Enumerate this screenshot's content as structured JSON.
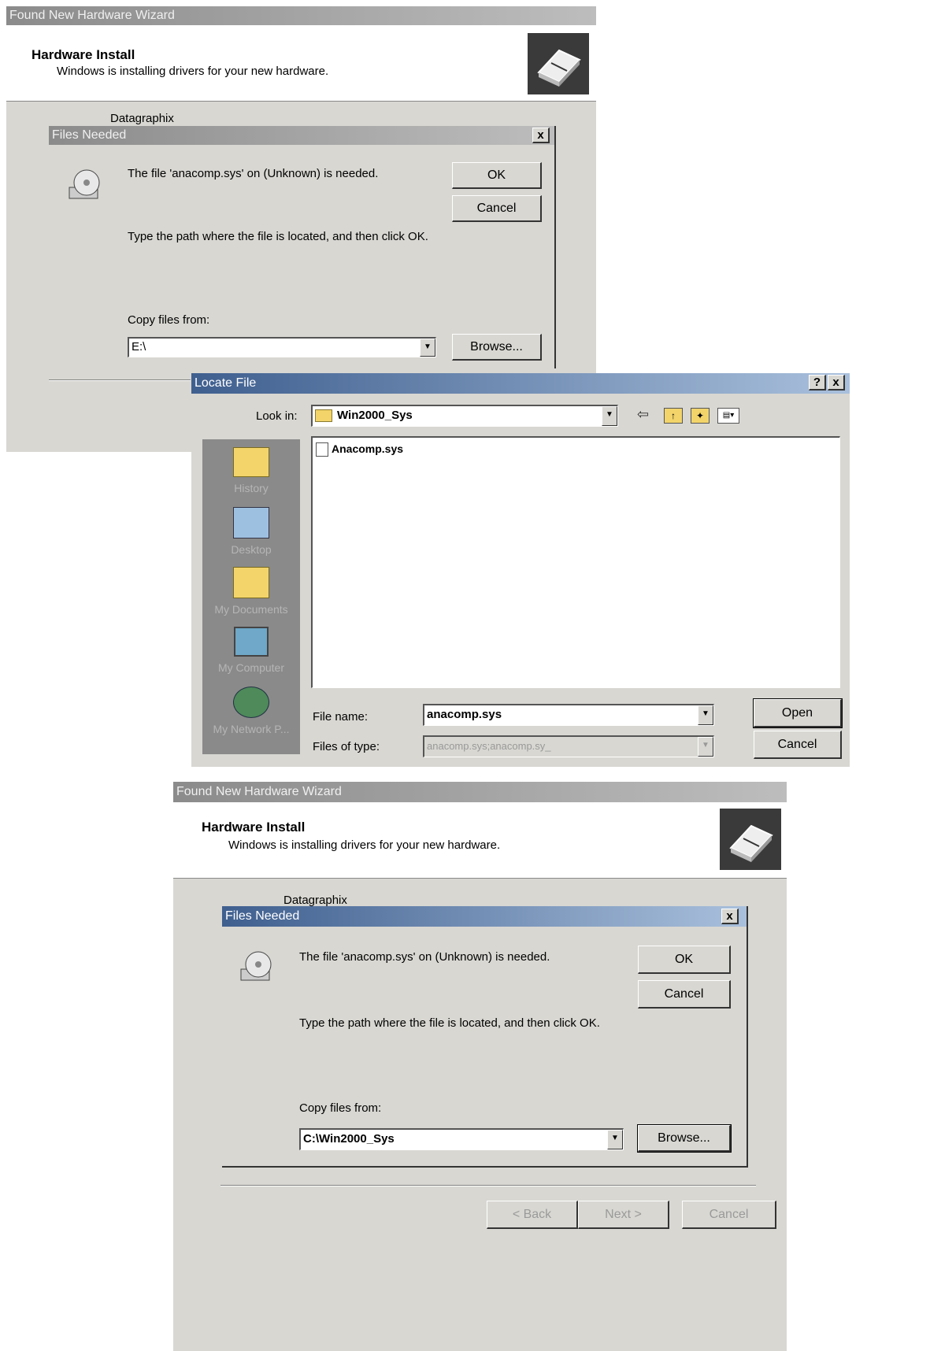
{
  "wizard": {
    "title": "Found New Hardware Wizard",
    "header_title": "Hardware Install",
    "header_subtitle": "Windows is installing drivers for your new hardware.",
    "device_name": "Datagraphix",
    "back_label": "< Back",
    "next_label": "Next >",
    "cancel_label": "Cancel"
  },
  "files_needed_top": {
    "title": "Files Needed",
    "close_label": "x",
    "message": "The file 'anacomp.sys' on (Unknown) is needed.",
    "instruction": "Type the path where the file is located, and then click OK.",
    "ok_label": "OK",
    "cancel_label": "Cancel",
    "copy_label": "Copy files from:",
    "copy_value": "E:\\",
    "browse_label": "Browse..."
  },
  "locate_file": {
    "title": "Locate File",
    "help_label": "?",
    "close_label": "x",
    "look_in_label": "Look in:",
    "look_in_value": "Win2000_Sys",
    "toolbar": {
      "back_icon": "back-arrow-icon",
      "up_icon": "up-folder-icon",
      "new_folder_icon": "new-folder-icon",
      "views_icon": "views-menu-icon"
    },
    "places": [
      {
        "label": "History",
        "icon": "history-folder-icon"
      },
      {
        "label": "Desktop",
        "icon": "desktop-icon"
      },
      {
        "label": "My Documents",
        "icon": "my-documents-icon"
      },
      {
        "label": "My Computer",
        "icon": "my-computer-icon"
      },
      {
        "label": "My Network P...",
        "icon": "my-network-places-icon"
      }
    ],
    "files": [
      "Anacomp.sys"
    ],
    "file_name_label": "File name:",
    "file_name_value": "anacomp.sys",
    "file_type_label": "Files of type:",
    "file_type_value": "anacomp.sys;anacomp.sy_",
    "open_label": "Open",
    "cancel_label": "Cancel"
  },
  "files_needed_bottom": {
    "title": "Files Needed",
    "close_label": "x",
    "message": "The file 'anacomp.sys' on (Unknown) is needed.",
    "instruction": "Type the path where the file is located, and then click OK.",
    "ok_label": "OK",
    "cancel_label": "Cancel",
    "copy_label": "Copy files from:",
    "copy_value": "C:\\Win2000_Sys",
    "browse_label": "Browse..."
  }
}
